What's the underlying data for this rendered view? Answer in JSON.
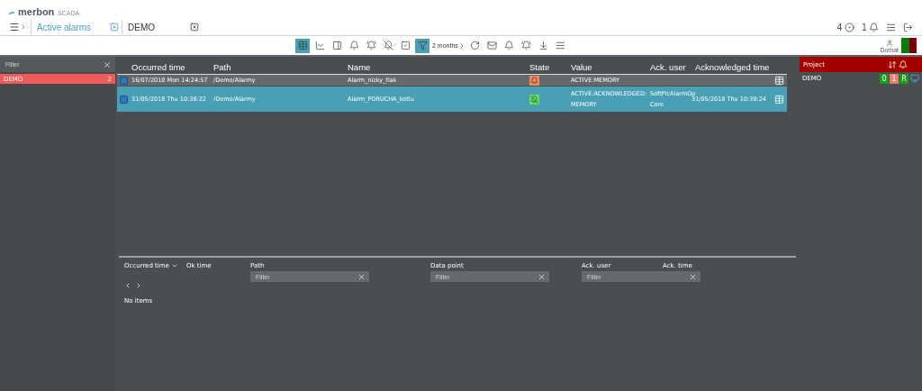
{
  "header": {
    "logo": {
      "brand": "merbon",
      "product": "SCADA"
    },
    "tabs": [
      {
        "label": "Active alarms",
        "selected": true
      },
      {
        "label": "DEMO",
        "selected": false
      }
    ],
    "counters": [
      {
        "value": "4",
        "kind": "target"
      },
      {
        "value": "1",
        "kind": "bell"
      }
    ]
  },
  "toolbar": {
    "tools": [
      {
        "kind": "table",
        "selected": true
      },
      {
        "kind": "chart",
        "selected": false
      },
      {
        "kind": "panel",
        "selected": false
      },
      {
        "kind": "bell",
        "selected": false
      },
      {
        "kind": "bell-ring",
        "selected": false
      },
      {
        "kind": "bell-off",
        "selected": false
      },
      {
        "kind": "check",
        "selected": false
      },
      {
        "kind": "filter",
        "selected": true
      }
    ],
    "period": "2 months",
    "actions": [
      {
        "kind": "refresh"
      },
      {
        "kind": "mail"
      },
      {
        "kind": "bell"
      },
      {
        "kind": "bell-ring"
      },
      {
        "kind": "download"
      },
      {
        "kind": "list"
      }
    ],
    "user": {
      "name": "Domat"
    }
  },
  "filter_panel": {
    "placeholder": "Filter",
    "items": [
      {
        "label": "DEMO",
        "count": "2",
        "selected": true
      }
    ]
  },
  "alarms": {
    "columns": [
      "Occurred time",
      "Path",
      "Name",
      "State",
      "Value",
      "Ack. user",
      "Acknowledged time"
    ],
    "rows": [
      {
        "occurred": "16/07/2018 Mon 14:24:57",
        "path": "/Demo/Alarmy",
        "name": "Alarm_nizky_tlak",
        "kind": "active",
        "value": "ACTIVE:MEMORY",
        "selected": false
      },
      {
        "occurred": "31/05/2018 Thu 10:38:22",
        "path": "/Demo/Alarmy",
        "name": "Alarm_PORUCHA_kotlu",
        "kind": "acknowledged",
        "value": "ACTIVE:ACKNOWLEDGED: MEMORY",
        "ack_user": "SoftPlcAlarmOp Core",
        "ack_time": "31/05/2018 Thu 10:38:24",
        "selected": true
      }
    ]
  },
  "history": {
    "columns": [
      {
        "label": "Occurred time",
        "sorted": true
      },
      {
        "label": "Ok time",
        "sorted": false
      },
      {
        "label": "Path",
        "sorted": false,
        "placeholder": "Filter"
      },
      {
        "label": "Data point",
        "sorted": false,
        "placeholder": "Filter"
      },
      {
        "label": "Ack. user",
        "sorted": false,
        "placeholder": "Filter"
      },
      {
        "label": "Ack. time",
        "sorted": false
      }
    ],
    "empty": "No items"
  },
  "projects": {
    "header": "Project",
    "rows": [
      {
        "name": "DEMO",
        "badges": [
          {
            "text": "0",
            "color": "#16a016"
          },
          {
            "text": "1",
            "color": "#f07a72"
          },
          {
            "text": "R",
            "color": "#16a016"
          }
        ]
      }
    ]
  }
}
